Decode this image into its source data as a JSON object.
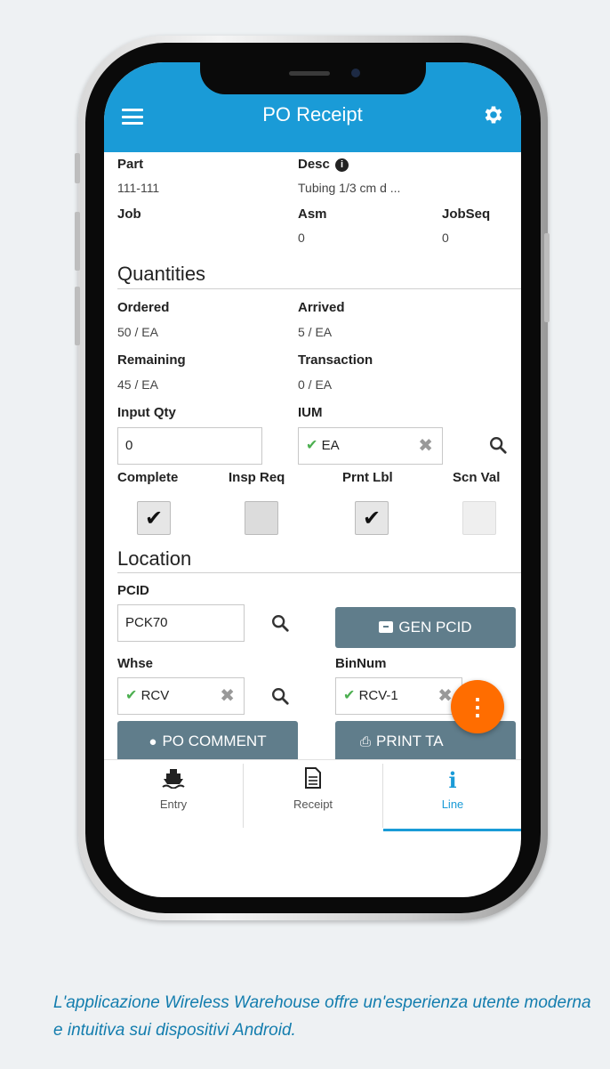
{
  "app": {
    "title": "PO Receipt",
    "accent_color": "#1a9bd7",
    "menu_icon": "hamburger-menu-icon",
    "settings_icon": "gear-icon"
  },
  "detail": {
    "part_label": "Part",
    "part_value": "111-111",
    "desc_label": "Desc",
    "desc_value": "Tubing 1/3 cm d ...",
    "job_label": "Job",
    "job_value": "",
    "asm_label": "Asm",
    "asm_value": "0",
    "jobseq_label": "JobSeq",
    "jobseq_value": "0"
  },
  "quantities": {
    "section_title": "Quantities",
    "ordered_label": "Ordered",
    "ordered_value": "50 / EA",
    "arrived_label": "Arrived",
    "arrived_value": "5 / EA",
    "remaining_label": "Remaining",
    "remaining_value": "45 / EA",
    "transaction_label": "Transaction",
    "transaction_value": "0 / EA",
    "input_qty_label": "Input Qty",
    "input_qty_value": "0",
    "ium_label": "IUM",
    "ium_value": "EA"
  },
  "flags": {
    "complete_label": "Complete",
    "complete_checked": true,
    "insp_req_label": "Insp Req",
    "insp_req_checked": false,
    "prnt_lbl_label": "Prnt Lbl",
    "prnt_lbl_checked": true,
    "scn_val_label": "Scn Val",
    "scn_val_checked": false
  },
  "location": {
    "section_title": "Location",
    "pcid_label": "PCID",
    "pcid_value": "PCK70",
    "gen_pcid_label": "GEN PCID",
    "whse_label": "Whse",
    "whse_value": "RCV",
    "binnum_label": "BinNum",
    "binnum_value": "RCV-1"
  },
  "actions": {
    "po_comment_label": "PO COMMENT",
    "print_tag_label": "PRINT TA",
    "fab_color": "#ff6d00"
  },
  "nav": {
    "items": [
      {
        "label": "Entry",
        "icon": "ship-icon"
      },
      {
        "label": "Receipt",
        "icon": "document-icon"
      },
      {
        "label": "Line",
        "icon": "info-icon"
      }
    ],
    "active": "Line"
  },
  "caption": "L'applicazione Wireless Warehouse offre un'esperienza utente moderna e intuitiva sui dispositivi Android."
}
